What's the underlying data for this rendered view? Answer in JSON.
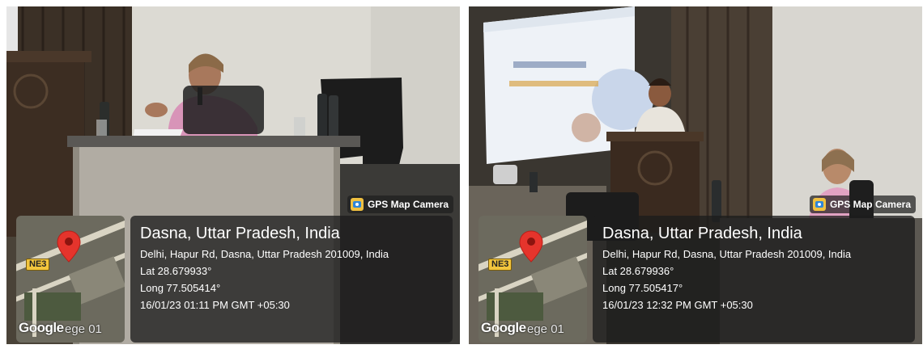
{
  "photos": [
    {
      "badge": {
        "icon": "gps-map-camera-icon",
        "label": "GPS Map Camera"
      },
      "map": {
        "road_label": "NE3",
        "brand": "Google",
        "underlay_text": "ege 01",
        "pin_icon": "map-pin-icon"
      },
      "location": {
        "title": "Dasna, Uttar Pradesh, India",
        "address": "Delhi, Hapur Rd, Dasna, Uttar Pradesh 201009, India",
        "lat": "Lat 28.679933°",
        "long": "Long 77.505414°",
        "timestamp": "16/01/23 01:11 PM GMT +05:30"
      }
    },
    {
      "badge": {
        "icon": "gps-map-camera-icon",
        "label": "GPS Map Camera"
      },
      "map": {
        "road_label": "NE3",
        "brand": "Google",
        "underlay_text": "ege 01",
        "pin_icon": "map-pin-icon"
      },
      "location": {
        "title": "Dasna, Uttar Pradesh, India",
        "address": "Delhi, Hapur Rd, Dasna, Uttar Pradesh 201009, India",
        "lat": "Lat 28.679936°",
        "long": "Long 77.505417°",
        "timestamp": "16/01/23 12:32 PM GMT +05:30"
      }
    }
  ]
}
